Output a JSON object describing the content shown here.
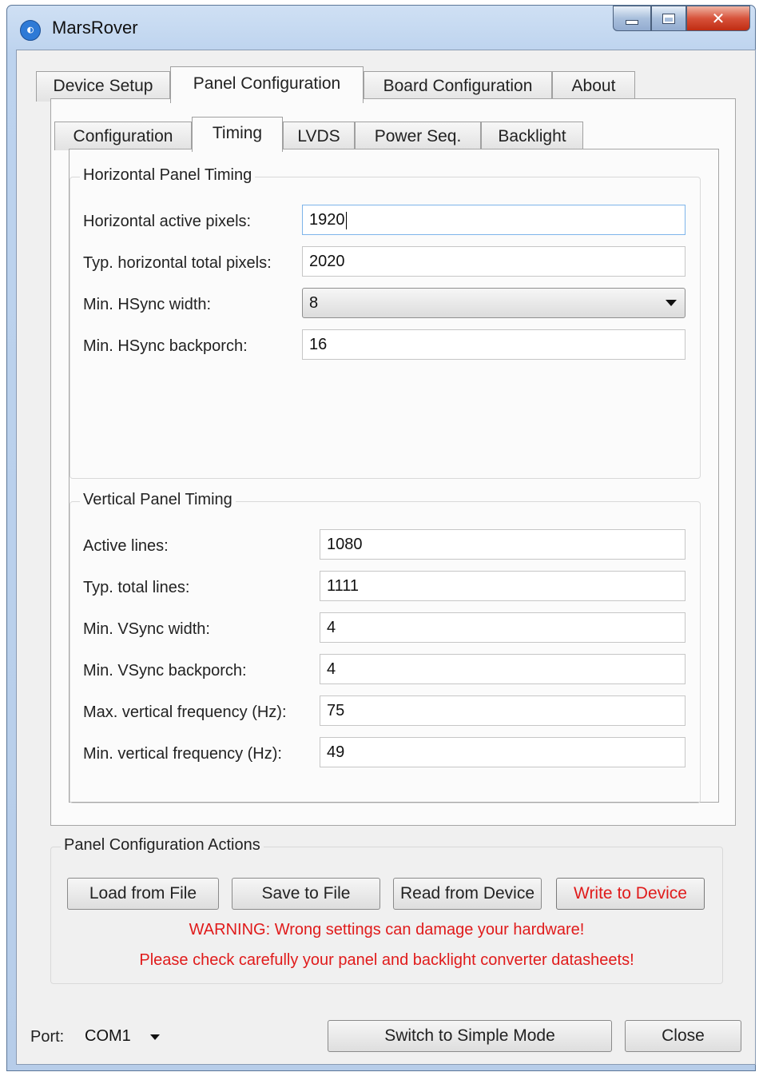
{
  "window": {
    "title": "MarsRover",
    "icon": "app-logo-icon",
    "controls": {
      "minimize": "minimize-icon",
      "maximize": "maximize-icon",
      "close": "close-icon"
    }
  },
  "main_tabs": [
    {
      "label": "Device Setup",
      "active": false
    },
    {
      "label": "Panel Configuration",
      "active": true
    },
    {
      "label": "Board Configuration",
      "active": false
    },
    {
      "label": "About",
      "active": false
    }
  ],
  "sub_tabs": [
    {
      "label": "Configuration",
      "active": false
    },
    {
      "label": "Timing",
      "active": true
    },
    {
      "label": "LVDS",
      "active": false
    },
    {
      "label": "Power Seq.",
      "active": false
    },
    {
      "label": "Backlight",
      "active": false
    }
  ],
  "horizontal": {
    "title": "Horizontal Panel Timing",
    "active_pixels_label": "Horizontal active pixels:",
    "active_pixels": "1920",
    "total_pixels_label": "Typ. horizontal total pixels:",
    "total_pixels": "2020",
    "hsync_width_label": "Min. HSync width:",
    "hsync_width": "8",
    "hsync_backporch_label": "Min. HSync backporch:",
    "hsync_backporch": "16"
  },
  "vertical": {
    "title": "Vertical Panel Timing",
    "active_lines_label": "Active lines:",
    "active_lines": "1080",
    "total_lines_label": "Typ. total lines:",
    "total_lines": "1111",
    "vsync_width_label": "Min. VSync width:",
    "vsync_width": "4",
    "vsync_backporch_label": "Min. VSync backporch:",
    "vsync_backporch": "4",
    "max_freq_label": "Max. vertical frequency (Hz):",
    "max_freq": "75",
    "min_freq_label": "Min. vertical frequency (Hz):",
    "min_freq": "49"
  },
  "actions": {
    "title": "Panel Configuration Actions",
    "load": "Load from File",
    "save": "Save to File",
    "read": "Read from Device",
    "write": "Write to Device",
    "warning1": "WARNING: Wrong settings can damage your hardware!",
    "warning2": "Please check carefully your panel and backlight converter datasheets!"
  },
  "footer": {
    "port_label": "Port:",
    "port_value": "COM1",
    "switch_mode": "Switch to Simple Mode",
    "close": "Close"
  },
  "colors": {
    "warning": "#e01b1b",
    "accent": "#2e7ad6"
  }
}
